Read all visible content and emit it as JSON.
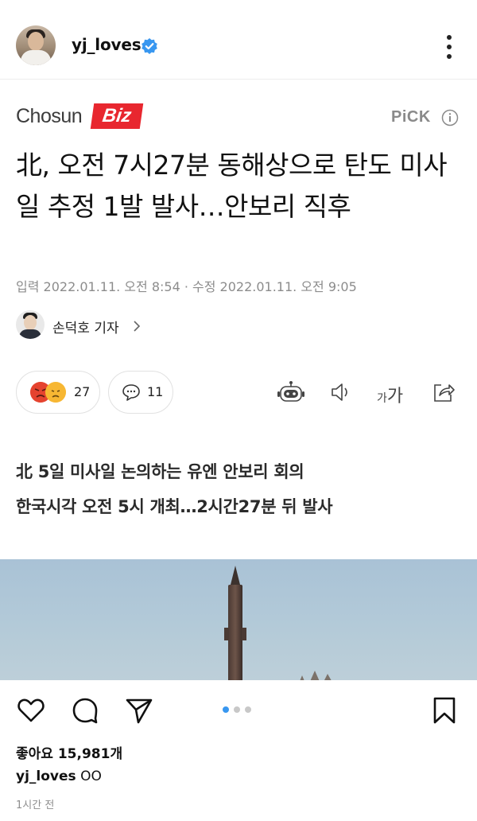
{
  "header": {
    "username": "yj_loves",
    "verified": true,
    "more_icon": "more-vertical-icon"
  },
  "article": {
    "brand": {
      "name_part1": "Chosun",
      "name_part2": "Biz",
      "brand_color": "#e8272f"
    },
    "pick_label": "PiCK",
    "headline": "北, 오전 7시27분 동해상으로 탄도 미사일 추정 1발 발사…안보리 직후",
    "dates": "입력 2022.01.11. 오전 8:54 · 수정 2022.01.11. 오전 9:05",
    "reporter": "손덕호 기자",
    "reaction_count": "27",
    "comment_count": "11",
    "font_size_label": "가가",
    "subheads": [
      "北 5일 미사일 논의하는 유엔 안보리 회의",
      "한국시각 오전 5시 개최…2시간27분 뒤 발사"
    ]
  },
  "post": {
    "likes": "좋아요 15,981개",
    "caption_user": "yj_loves",
    "caption_text": "OO",
    "time": "1시간 전",
    "carousel": {
      "count": 3,
      "active": 0,
      "active_color": "#3897f0"
    }
  }
}
